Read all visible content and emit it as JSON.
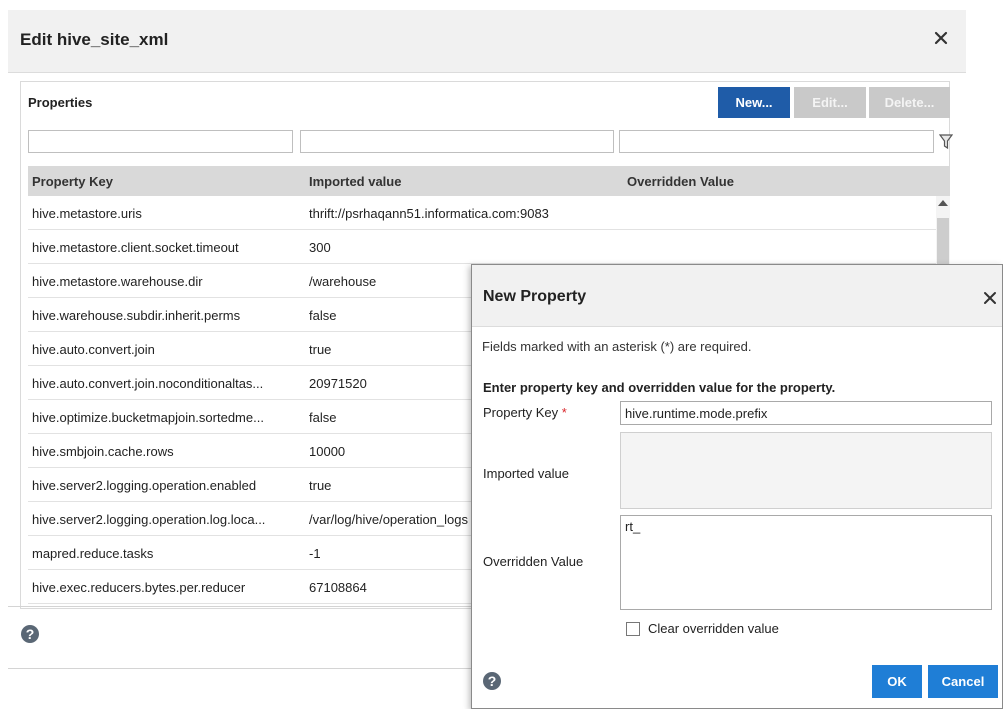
{
  "main_dialog": {
    "title": "Edit hive_site_xml",
    "close_icon": "close-icon",
    "panel_label": "Properties",
    "buttons": {
      "new": "New...",
      "edit": "Edit...",
      "delete": "Delete..."
    },
    "filter_icon": "filter-icon",
    "columns": [
      "Property Key",
      "Imported value",
      "Overridden Value"
    ],
    "rows": [
      {
        "key": "hive.metastore.uris",
        "imported": "thrift://psrhaqann51.informatica.com:9083",
        "overridden": ""
      },
      {
        "key": "hive.metastore.client.socket.timeout",
        "imported": "300",
        "overridden": ""
      },
      {
        "key": "hive.metastore.warehouse.dir",
        "imported": "/warehouse",
        "overridden": ""
      },
      {
        "key": "hive.warehouse.subdir.inherit.perms",
        "imported": "false",
        "overridden": ""
      },
      {
        "key": "hive.auto.convert.join",
        "imported": "true",
        "overridden": ""
      },
      {
        "key": "hive.auto.convert.join.noconditionaltas...",
        "imported": "20971520",
        "overridden": ""
      },
      {
        "key": "hive.optimize.bucketmapjoin.sortedme...",
        "imported": "false",
        "overridden": ""
      },
      {
        "key": "hive.smbjoin.cache.rows",
        "imported": "10000",
        "overridden": ""
      },
      {
        "key": "hive.server2.logging.operation.enabled",
        "imported": "true",
        "overridden": ""
      },
      {
        "key": "hive.server2.logging.operation.log.loca...",
        "imported": "/var/log/hive/operation_logs",
        "overridden": ""
      },
      {
        "key": "mapred.reduce.tasks",
        "imported": "-1",
        "overridden": ""
      },
      {
        "key": "hive.exec.reducers.bytes.per.reducer",
        "imported": "67108864",
        "overridden": ""
      }
    ],
    "help_icon": "help-icon"
  },
  "new_property_dialog": {
    "title": "New Property",
    "close_icon": "close-icon",
    "required_note": "Fields marked with an asterisk (*) are required.",
    "instruction": "Enter property key and overridden value for the property.",
    "property_key_label": "Property Key",
    "required_marker": "*",
    "property_key_value": "hive.runtime.mode.prefix",
    "imported_value_label": "Imported value",
    "imported_value": "",
    "overridden_value_label": "Overridden Value",
    "overridden_value": "rt_",
    "clear_label": "Clear overridden value",
    "clear_checked": false,
    "help_icon": "help-icon",
    "ok_label": "OK",
    "cancel_label": "Cancel"
  },
  "colors": {
    "primary_button": "#1f5ca8",
    "dialog_button": "#1f7ed6",
    "disabled_button": "#c9c9c9",
    "header_bg": "#f1f1f1",
    "grid_header_bg": "#d9d9d9",
    "required": "#d9262a"
  }
}
